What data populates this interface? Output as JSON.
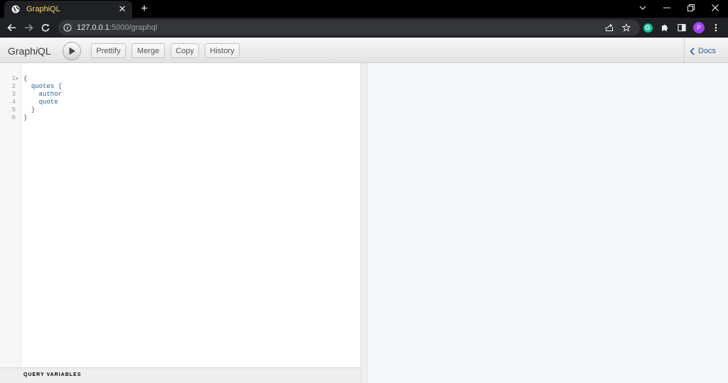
{
  "browser": {
    "tab": {
      "title": "GraphiQL",
      "favicon": "globe-icon"
    },
    "new_tab": "+",
    "url": {
      "host": "127.0.0.1",
      "path": ":5000/graphql"
    },
    "profile_initial": "P",
    "extension_initial": "G"
  },
  "graphiql": {
    "logo": {
      "pre": "Graph",
      "italic": "i",
      "post": "QL"
    },
    "toolbar": {
      "prettify": "Prettify",
      "merge": "Merge",
      "copy": "Copy",
      "history": "History"
    },
    "docs": "Docs",
    "query": {
      "line_numbers": [
        "1",
        "2",
        "3",
        "4",
        "5",
        "6"
      ],
      "lines": [
        {
          "indent": "",
          "text": "{",
          "kind": "punct"
        },
        {
          "indent": "  ",
          "text": "quotes {",
          "kind": "field"
        },
        {
          "indent": "    ",
          "text": "author",
          "kind": "field"
        },
        {
          "indent": "    ",
          "text": "quote",
          "kind": "field"
        },
        {
          "indent": "  ",
          "text": "}",
          "kind": "punct"
        },
        {
          "indent": "",
          "text": "}",
          "kind": "punct"
        }
      ]
    },
    "variables_title": "QUERY VARIABLES"
  },
  "colors": {
    "tab_title": "#f6d76a",
    "field": "#1f61a0",
    "docs_link": "#3b5998"
  }
}
